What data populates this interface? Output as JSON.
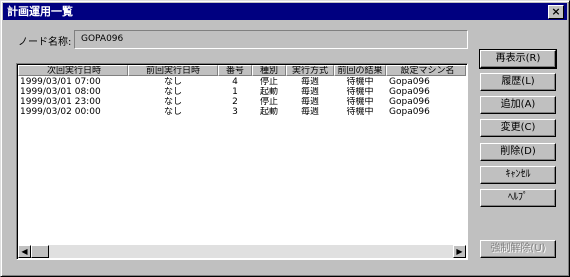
{
  "window": {
    "title": "計画運用一覧",
    "close_glyph": "×"
  },
  "node": {
    "label": "ノード名称:",
    "value": "GOPA096"
  },
  "table": {
    "columns": [
      "次回実行日時",
      "前回実行日時",
      "番号",
      "種別",
      "実行方式",
      "前回の結果",
      "設定マシン名"
    ],
    "rows": [
      [
        "1999/03/01 07:00",
        "なし",
        "4",
        "停止",
        "毎週",
        "待機中",
        "Gopa096"
      ],
      [
        "1999/03/01 08:00",
        "なし",
        "1",
        "起動",
        "毎週",
        "待機中",
        "Gopa096"
      ],
      [
        "1999/03/01 23:00",
        "なし",
        "2",
        "停止",
        "毎週",
        "待機中",
        "Gopa096"
      ],
      [
        "1999/03/02 00:00",
        "なし",
        "3",
        "起動",
        "毎週",
        "待機中",
        "Gopa096"
      ]
    ]
  },
  "scrollbar": {
    "left_glyph": "◀",
    "right_glyph": "▶"
  },
  "buttons": {
    "refresh": "再表示(R)",
    "history": "履歴(L)",
    "add": "追加(A)",
    "modify": "変更(C)",
    "delete": "削除(D)",
    "cancel": "ｷｬﾝｾﾙ",
    "help": "ﾍﾙﾌﾟ",
    "force_release": "強制解除(U)"
  }
}
